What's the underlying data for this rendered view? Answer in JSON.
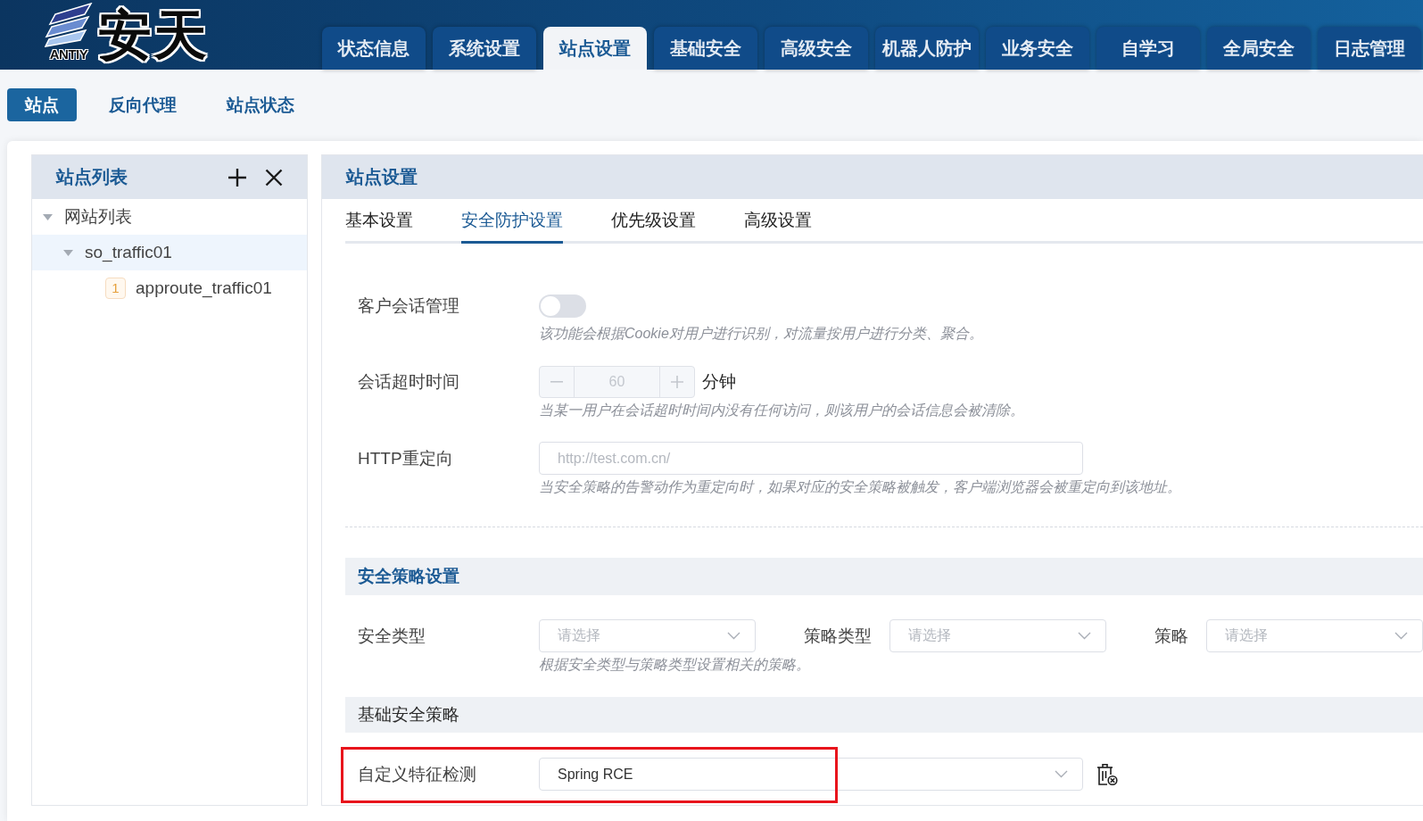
{
  "logo": {
    "caption": "ANTIY",
    "name": "安天"
  },
  "main_tabs": [
    {
      "label": "状态信息",
      "selected": false
    },
    {
      "label": "系统设置",
      "selected": false
    },
    {
      "label": "站点设置",
      "selected": true
    },
    {
      "label": "基础安全",
      "selected": false
    },
    {
      "label": "高级安全",
      "selected": false
    },
    {
      "label": "机器人防护",
      "selected": false
    },
    {
      "label": "业务安全",
      "selected": false
    },
    {
      "label": "自学习",
      "selected": false
    },
    {
      "label": "全局安全",
      "selected": false
    },
    {
      "label": "日志管理",
      "selected": false
    }
  ],
  "sub_nav": [
    {
      "label": "站点",
      "selected": true
    },
    {
      "label": "反向代理",
      "selected": false
    },
    {
      "label": "站点状态",
      "selected": false
    }
  ],
  "site_list": {
    "title": "站点列表",
    "tree": [
      {
        "label": "网站列表",
        "selected": false,
        "expanded": true,
        "children": [
          {
            "label": "so_traffic01",
            "selected": true,
            "expanded": true,
            "children": [
              {
                "badge": "1",
                "label": "approute_traffic01",
                "selected": false
              }
            ]
          }
        ]
      }
    ]
  },
  "site_settings": {
    "title": "站点设置",
    "tabs": [
      {
        "label": "基本设置",
        "selected": false
      },
      {
        "label": "安全防护设置",
        "selected": true
      },
      {
        "label": "优先级设置",
        "selected": false
      },
      {
        "label": "高级设置",
        "selected": false
      }
    ],
    "fields": [
      {
        "kind": "switch",
        "label": "客户会话管理",
        "on": false,
        "hint": "该功能会根据Cookie对用户进行识别，对流量按用户进行分类、聚合。"
      },
      {
        "kind": "stepper",
        "label": "会话超时时间",
        "value": "60",
        "unit": "分钟",
        "disabled": true,
        "hint": "当某一用户在会话超时时间内没有任何访问，则该用户的会话信息会被清除。"
      },
      {
        "kind": "text",
        "label": "HTTP重定向",
        "placeholder": "http://test.com.cn/",
        "hint": "当安全策略的告警动作为重定向时，如果对应的安全策略被触发，客户端浏览器会被重定向到该地址。"
      }
    ],
    "policy_section": {
      "title": "安全策略设置",
      "filters": [
        {
          "label": "安全类型",
          "placeholder": "请选择"
        },
        {
          "label": "策略类型",
          "placeholder": "请选择"
        },
        {
          "label": "策略",
          "placeholder": "请选择"
        }
      ],
      "hint": "根据安全类型与策略类型设置相关的策略。"
    },
    "basic_section": {
      "title": "基础安全策略",
      "rows": [
        {
          "label": "自定义特征检测",
          "value": "Spring RCE",
          "highlighted": true
        }
      ]
    }
  }
}
